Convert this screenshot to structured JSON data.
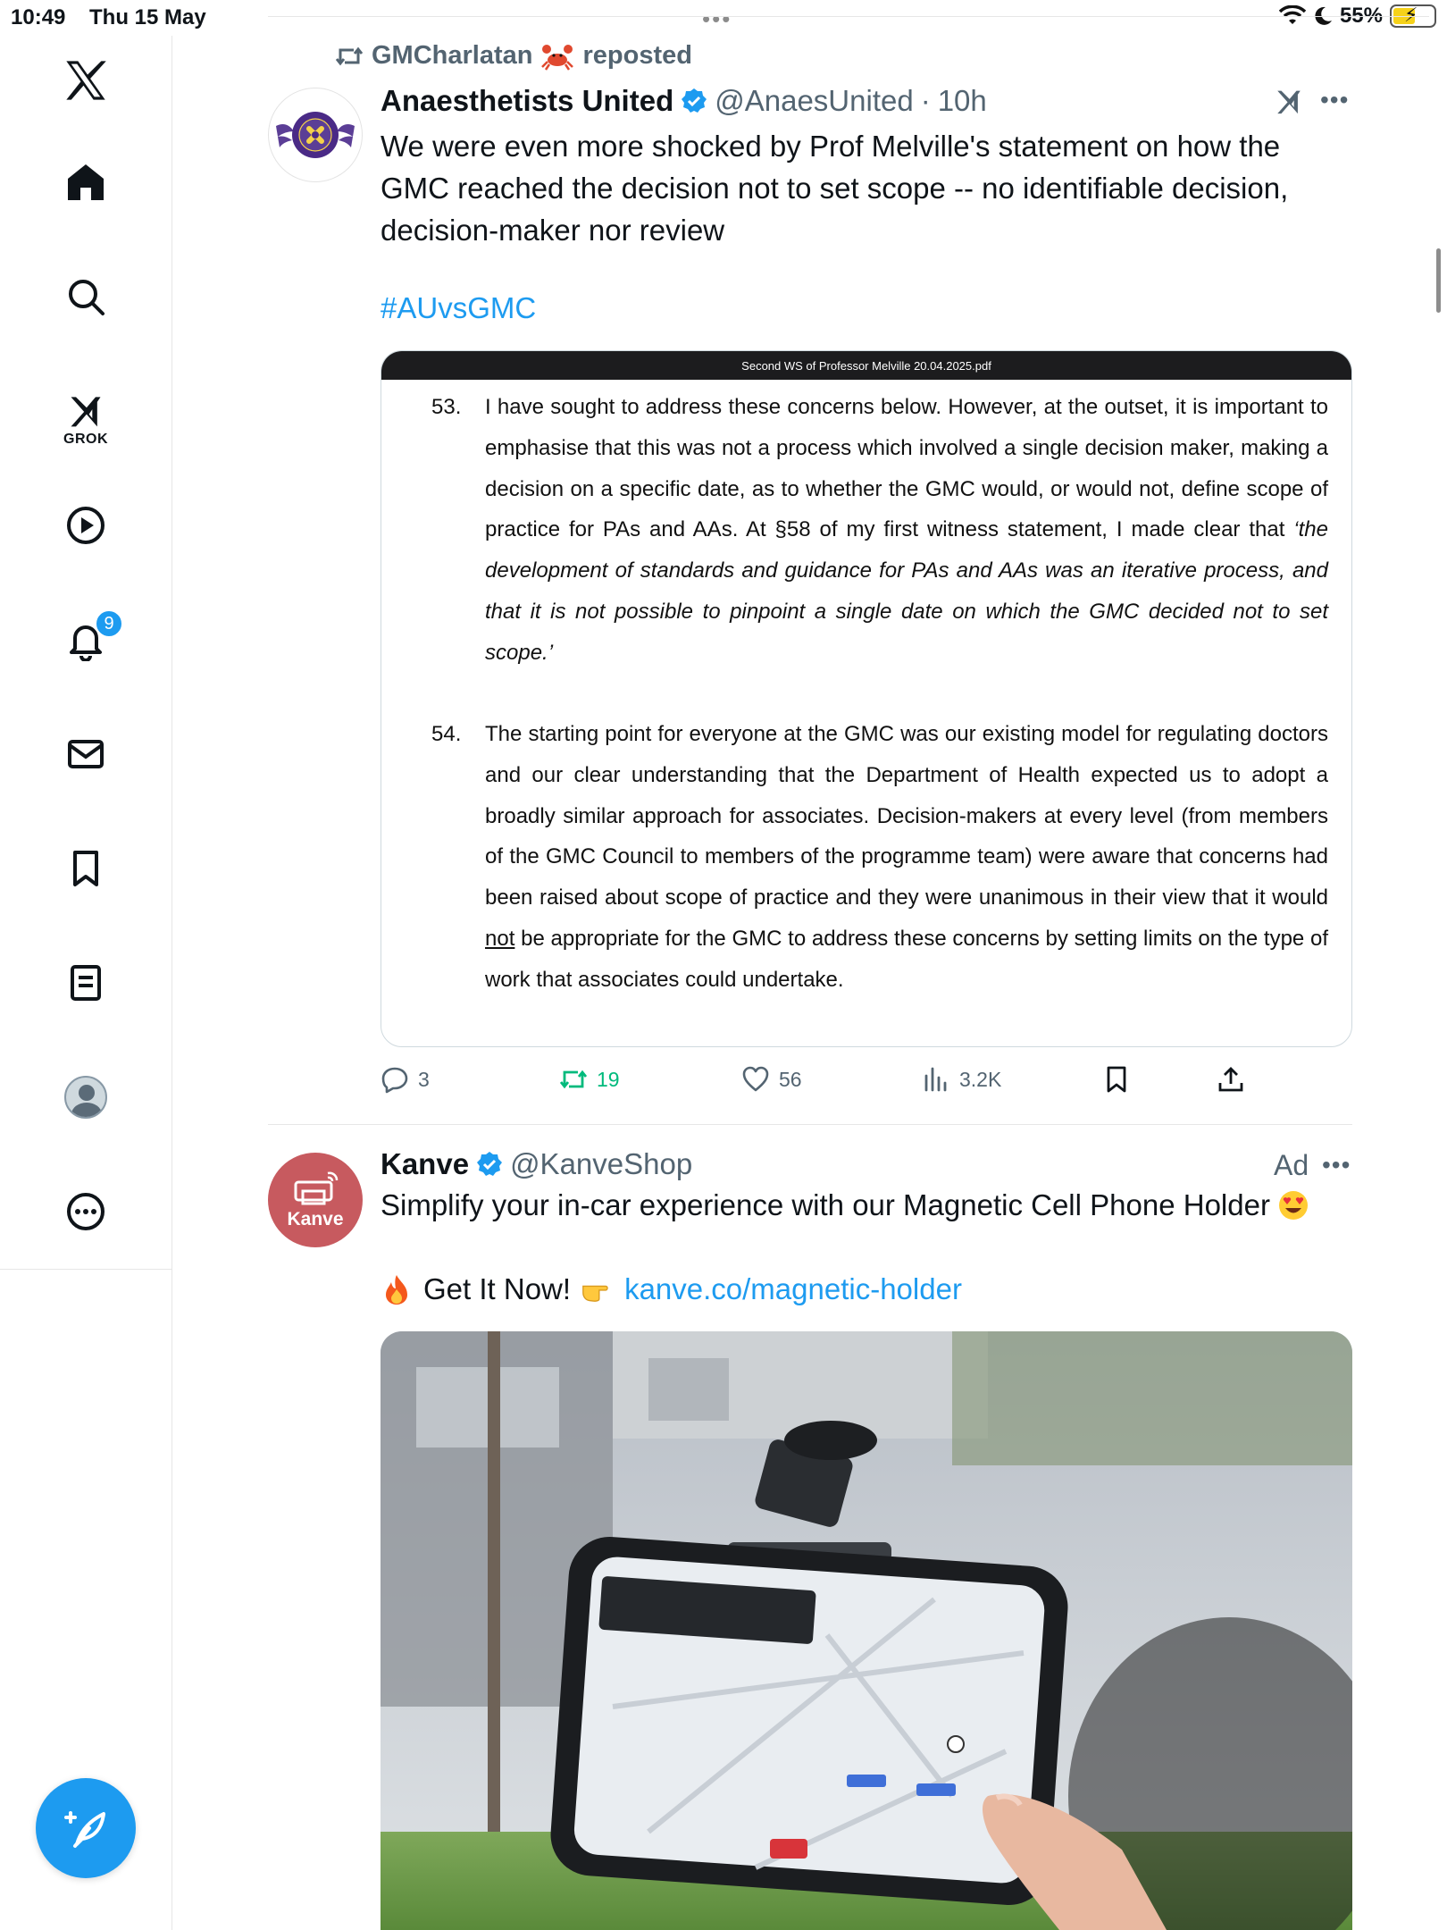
{
  "status_bar": {
    "time": "10:49",
    "date": "Thu 15 May",
    "battery": "55%",
    "battery_level": 0.55
  },
  "sidebar": {
    "items": [
      {
        "id": "x-logo",
        "label": "X"
      },
      {
        "id": "home",
        "label": "Home"
      },
      {
        "id": "search",
        "label": "Search"
      },
      {
        "id": "grok",
        "label": "GROK"
      },
      {
        "id": "video",
        "label": "Video"
      },
      {
        "id": "notifications",
        "label": "Notifications",
        "badge": "9"
      },
      {
        "id": "messages",
        "label": "Messages"
      },
      {
        "id": "bookmarks",
        "label": "Bookmarks"
      },
      {
        "id": "lists",
        "label": "Lists"
      },
      {
        "id": "profile",
        "label": "Profile"
      },
      {
        "id": "more",
        "label": "More"
      }
    ],
    "grok_label": "GROK",
    "notifications_badge": "9"
  },
  "tweet1": {
    "reposted_by": "GMCharlatan",
    "reposted_label": "reposted",
    "author_name": "Anaesthetists United",
    "handle": "@AnaesUnited",
    "time": "10h",
    "text_lines": [
      "We were even more shocked by Prof Melville's statement on how the",
      "GMC reached the decision not to set scope -- no identifiable decision,",
      "decision-maker nor review"
    ],
    "hashtag": "#AUvsGMC",
    "document": {
      "title": "Second WS of Professor Melville 20.04.2025.pdf",
      "para53_num": "53.",
      "para53_text": "I have sought to address these concerns below. However, at the outset, it is important to emphasise that this was not a process which involved a single decision maker, making a decision on a specific date, as to whether the GMC would, or would not, define scope of practice for PAs and AAs. At §58 of my first witness statement, I made clear that ",
      "para53_quote": "‘the development of standards and guidance for PAs and AAs was an iterative process, and that it is not possible to pinpoint a single date on which the GMC decided not to set scope.’",
      "para54_num": "54.",
      "para54_text_a": "The starting point for everyone at the GMC was our existing model for regulating doctors and our clear understanding that the Department of Health expected us to adopt a broadly similar approach for associates. Decision-makers at every level (from members of the GMC Council to members of the programme team) were aware that concerns had been raised about scope of practice and they were unanimous in their view that it would ",
      "para54_underlined": "not",
      "para54_text_b": " be appropriate for the GMC to address these concerns by setting limits on the type of work that associates could undertake."
    },
    "stats": {
      "replies": "3",
      "reposts": "19",
      "likes": "56",
      "views": "3.2K"
    }
  },
  "tweet2": {
    "author_name": "Kanve",
    "handle": "@KanveShop",
    "avatar_text": "Kanve",
    "ad_label": "Ad",
    "text": "Simplify your in-car experience with our Magnetic Cell Phone Holder",
    "cta": "Get It Now!",
    "link": "kanve.co/magnetic-holder"
  },
  "colors": {
    "accent": "#1d9bf0",
    "repost_green": "#00ba7c",
    "secondary_text": "#536471",
    "kanve_red": "#c75a5f"
  }
}
